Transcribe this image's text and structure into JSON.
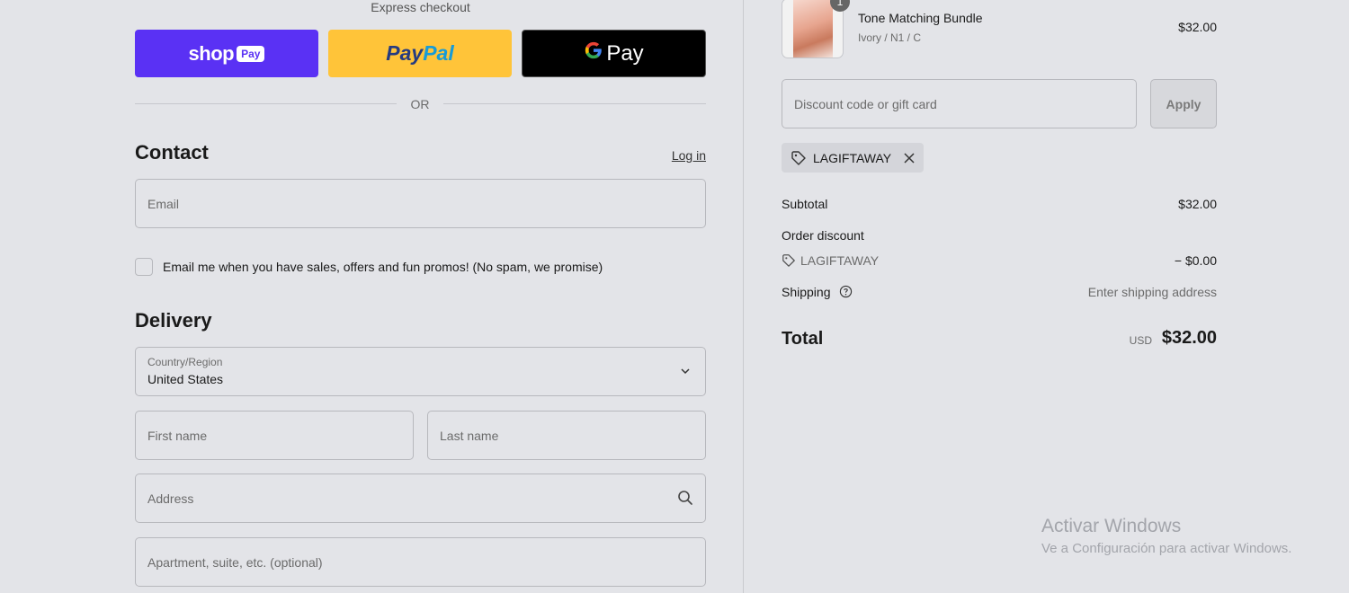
{
  "express": {
    "title": "Express checkout",
    "shop_pay": {
      "word": "shop",
      "badge": "Pay"
    },
    "paypal": {
      "part1": "Pay",
      "part2": "Pal"
    },
    "gpay": {
      "g": "G",
      "word": "Pay"
    },
    "or_text": "OR"
  },
  "contact": {
    "heading": "Contact",
    "login": "Log in",
    "email_placeholder": "Email",
    "newsletter_label": "Email me when you have sales, offers and fun promos! (No spam, we promise)"
  },
  "delivery": {
    "heading": "Delivery",
    "country_label": "Country/Region",
    "country_value": "United States",
    "first_name_placeholder": "First name",
    "last_name_placeholder": "Last name",
    "address_placeholder": "Address",
    "apartment_placeholder": "Apartment, suite, etc. (optional)"
  },
  "cart": {
    "item": {
      "quantity": "1",
      "name": "Tone Matching Bundle",
      "variant": "Ivory / N1 / C",
      "price": "$32.00"
    },
    "discount_placeholder": "Discount code or gift card",
    "apply_label": "Apply",
    "applied_code": "LAGIFTAWAY"
  },
  "summary": {
    "subtotal_label": "Subtotal",
    "subtotal_value": "$32.00",
    "order_discount_label": "Order discount",
    "discount_code": "LAGIFTAWAY",
    "discount_value": "− $0.00",
    "shipping_label": "Shipping",
    "shipping_value": "Enter shipping address",
    "total_label": "Total",
    "total_currency": "USD",
    "total_value": "$32.00"
  },
  "watermark": {
    "title": "Activar Windows",
    "subtitle": "Ve a Configuración para activar Windows."
  },
  "colors": {
    "background": "#e3e4e8",
    "shop_pay": "#5a31f4",
    "paypal": "#ffc439",
    "gpay": "#000000"
  }
}
